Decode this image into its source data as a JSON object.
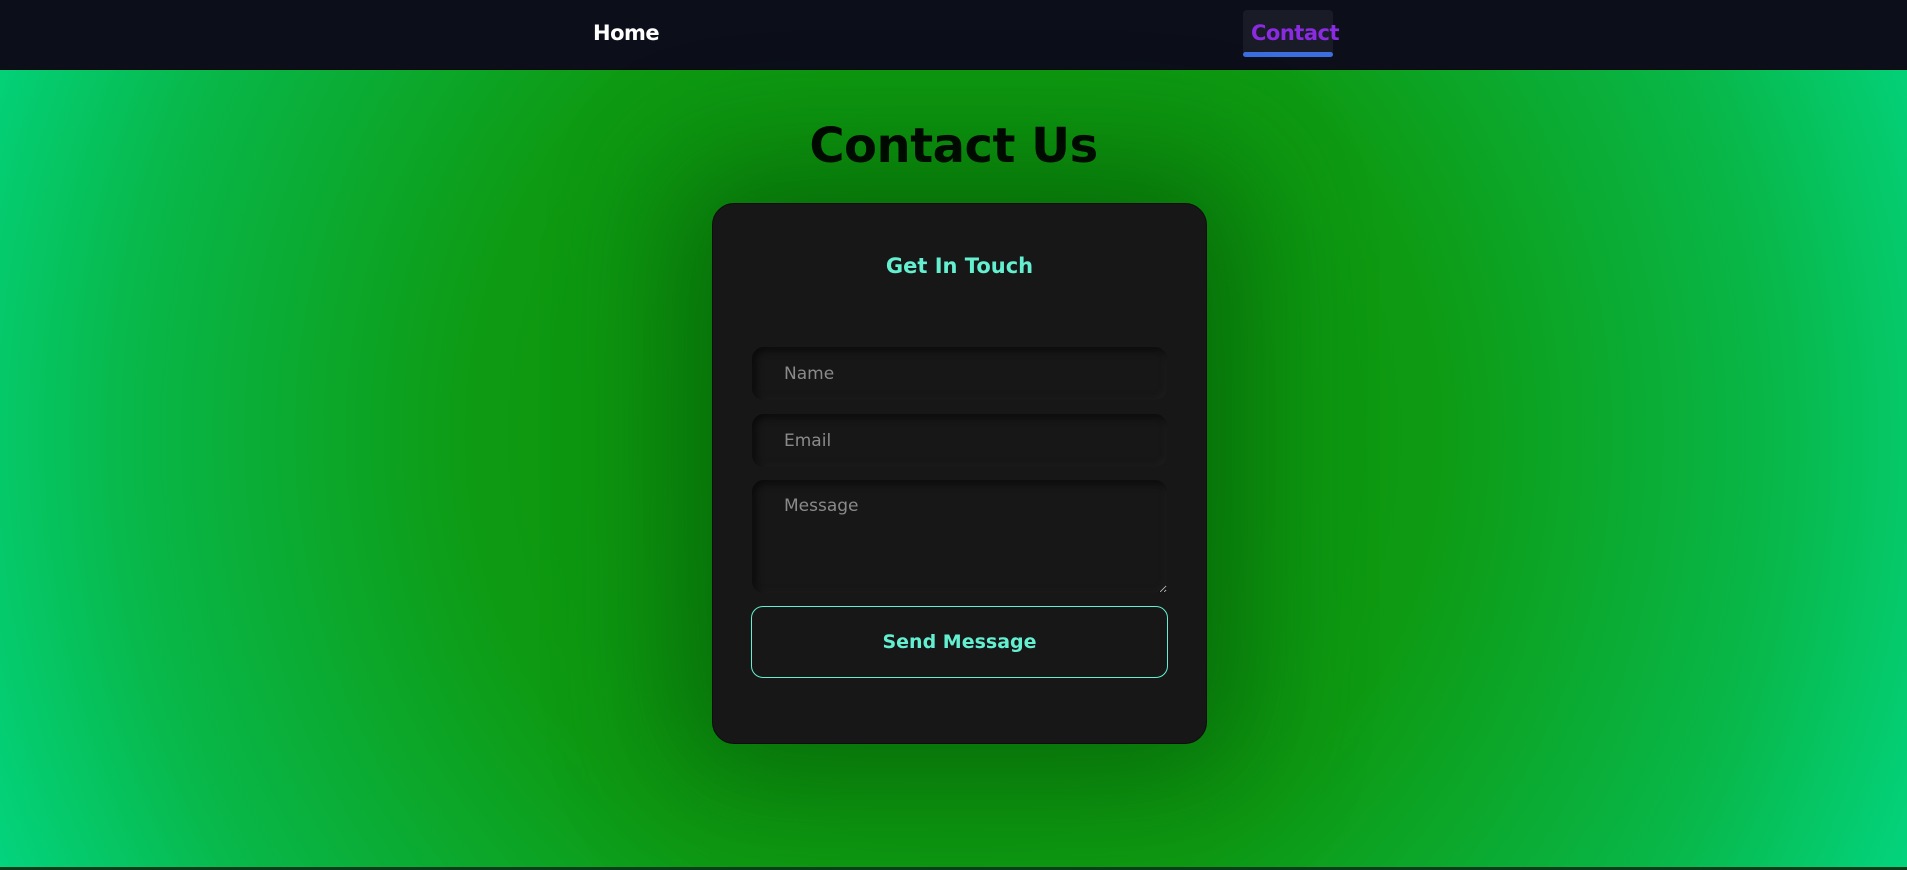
{
  "nav": {
    "home_label": "Home",
    "contact_label": "Contact",
    "active": "Contact"
  },
  "page": {
    "title": "Contact Us"
  },
  "form": {
    "heading": "Get In Touch",
    "name_placeholder": "Name",
    "email_placeholder": "Email",
    "message_placeholder": "Message",
    "name_value": "",
    "email_value": "",
    "message_value": "",
    "submit_label": "Send Message"
  },
  "colors": {
    "accent": "#64f0d0",
    "nav_active": "#8a2be2",
    "nav_underline": "#3b6fe0",
    "nav_background": "#0c0f1a",
    "card_background": "#171717"
  }
}
